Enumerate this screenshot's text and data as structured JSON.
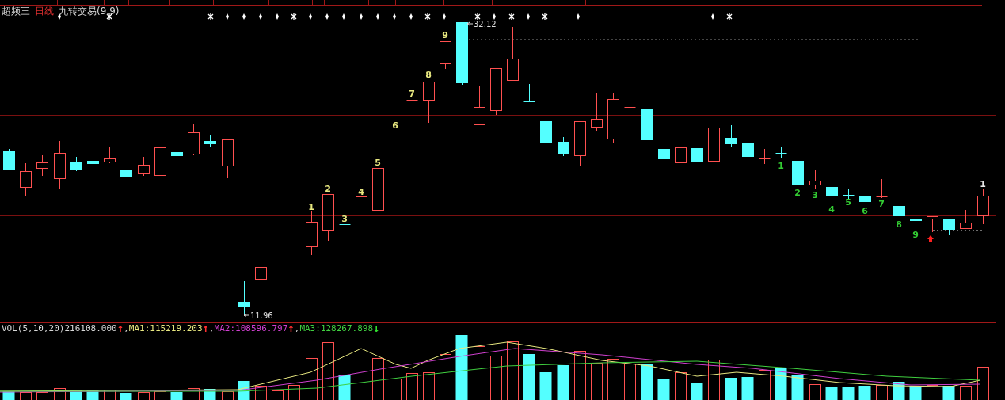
{
  "header": {
    "stock_name": "超频三",
    "period": "日线",
    "indicator": "九转交易(9,9)"
  },
  "price_labels": [
    {
      "text": "32.12",
      "kind": "high"
    },
    {
      "text": "11.96",
      "kind": "low"
    }
  ],
  "count_labels": [
    {
      "text": "1",
      "color": "#e8e880"
    },
    {
      "text": "2",
      "color": "#e8e880"
    },
    {
      "text": "3",
      "color": "#e8e880"
    },
    {
      "text": "4",
      "color": "#e8e880"
    },
    {
      "text": "5",
      "color": "#e8e880"
    },
    {
      "text": "6",
      "color": "#e8e880"
    },
    {
      "text": "7",
      "color": "#e8e880"
    },
    {
      "text": "8",
      "color": "#e8e880"
    },
    {
      "text": "9",
      "color": "#e8e880"
    },
    {
      "text": "1",
      "color": "#33cc33"
    },
    {
      "text": "2",
      "color": "#33cc33"
    },
    {
      "text": "3",
      "color": "#33cc33"
    },
    {
      "text": "4",
      "color": "#33cc33"
    },
    {
      "text": "5",
      "color": "#33cc33"
    },
    {
      "text": "6",
      "color": "#33cc33"
    },
    {
      "text": "7",
      "color": "#33cc33"
    },
    {
      "text": "8",
      "color": "#33cc33"
    },
    {
      "text": "9",
      "color": "#33cc33"
    },
    {
      "text": "1",
      "color": "#e8e8e8"
    }
  ],
  "volume": {
    "name": "VOL(5,10,20)",
    "value": "216108.000",
    "arrow": {
      "text": "↑",
      "color": "#ff3030"
    },
    "separator": ",",
    "averages": [
      {
        "label": "MA1:",
        "value": "115219.203",
        "arrow": {
          "text": "↑",
          "color": "#ff3030"
        },
        "separator": ",",
        "color": "#e8e880"
      },
      {
        "label": "MA2:",
        "value": "108596.797",
        "arrow": {
          "text": "↑",
          "color": "#ff3030"
        },
        "separator": ",",
        "color": "#d040d0"
      },
      {
        "label": "MA3:",
        "value": "128267.898",
        "arrow": {
          "text": "↓",
          "color": "#30e030"
        },
        "color": "#40d040"
      }
    ]
  }
}
